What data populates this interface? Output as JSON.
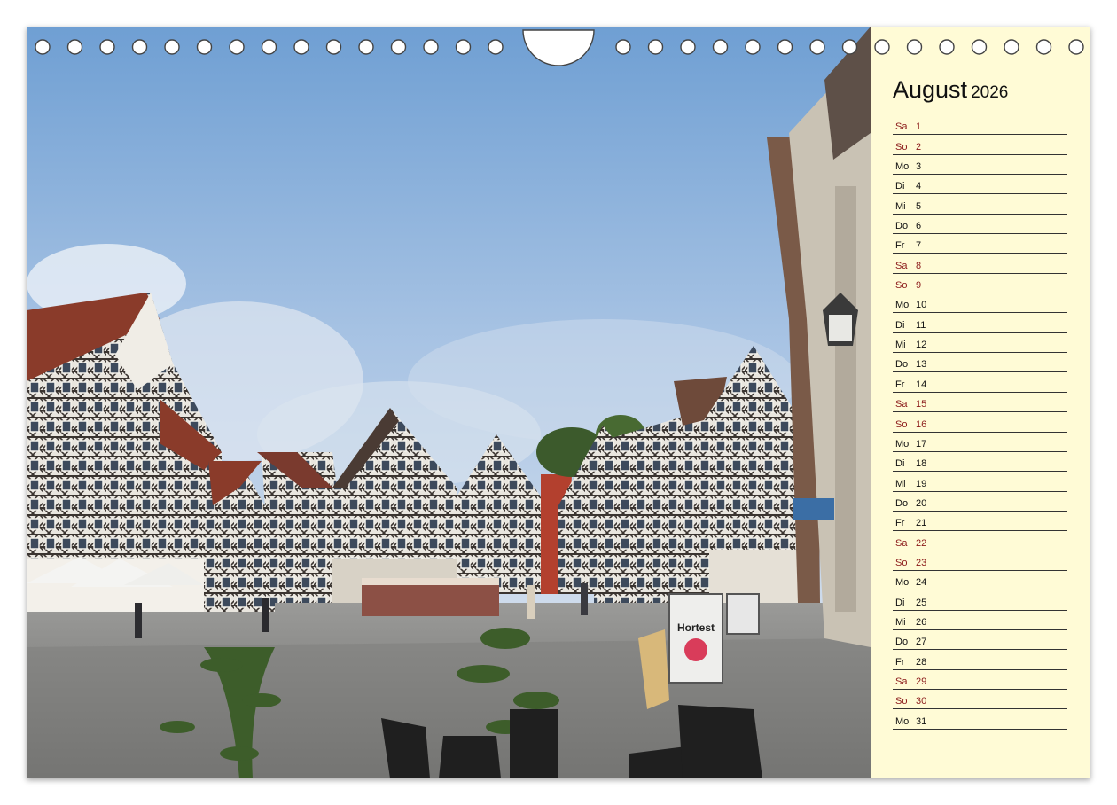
{
  "calendar": {
    "month": "August",
    "year": "2026",
    "days": [
      {
        "wd": "Sa",
        "d": "1",
        "weekend": true
      },
      {
        "wd": "So",
        "d": "2",
        "weekend": true
      },
      {
        "wd": "Mo",
        "d": "3",
        "weekend": false
      },
      {
        "wd": "Di",
        "d": "4",
        "weekend": false
      },
      {
        "wd": "Mi",
        "d": "5",
        "weekend": false
      },
      {
        "wd": "Do",
        "d": "6",
        "weekend": false
      },
      {
        "wd": "Fr",
        "d": "7",
        "weekend": false
      },
      {
        "wd": "Sa",
        "d": "8",
        "weekend": true
      },
      {
        "wd": "So",
        "d": "9",
        "weekend": true
      },
      {
        "wd": "Mo",
        "d": "10",
        "weekend": false
      },
      {
        "wd": "Di",
        "d": "11",
        "weekend": false
      },
      {
        "wd": "Mi",
        "d": "12",
        "weekend": false
      },
      {
        "wd": "Do",
        "d": "13",
        "weekend": false
      },
      {
        "wd": "Fr",
        "d": "14",
        "weekend": false
      },
      {
        "wd": "Sa",
        "d": "15",
        "weekend": true
      },
      {
        "wd": "So",
        "d": "16",
        "weekend": true
      },
      {
        "wd": "Mo",
        "d": "17",
        "weekend": false
      },
      {
        "wd": "Di",
        "d": "18",
        "weekend": false
      },
      {
        "wd": "Mi",
        "d": "19",
        "weekend": false
      },
      {
        "wd": "Do",
        "d": "20",
        "weekend": false
      },
      {
        "wd": "Fr",
        "d": "21",
        "weekend": false
      },
      {
        "wd": "Sa",
        "d": "22",
        "weekend": true
      },
      {
        "wd": "So",
        "d": "23",
        "weekend": true
      },
      {
        "wd": "Mo",
        "d": "24",
        "weekend": false
      },
      {
        "wd": "Di",
        "d": "25",
        "weekend": false
      },
      {
        "wd": "Mi",
        "d": "26",
        "weekend": false
      },
      {
        "wd": "Do",
        "d": "27",
        "weekend": false
      },
      {
        "wd": "Fr",
        "d": "28",
        "weekend": false
      },
      {
        "wd": "Sa",
        "d": "29",
        "weekend": true
      },
      {
        "wd": "So",
        "d": "30",
        "weekend": true
      },
      {
        "wd": "Mo",
        "d": "31",
        "weekend": false
      }
    ]
  },
  "photo": {
    "sign_text": "Hortest"
  },
  "colors": {
    "panel_bg": "#fffbd6",
    "weekend_text": "#8b1a1a",
    "sky": "#8fb3dc"
  }
}
